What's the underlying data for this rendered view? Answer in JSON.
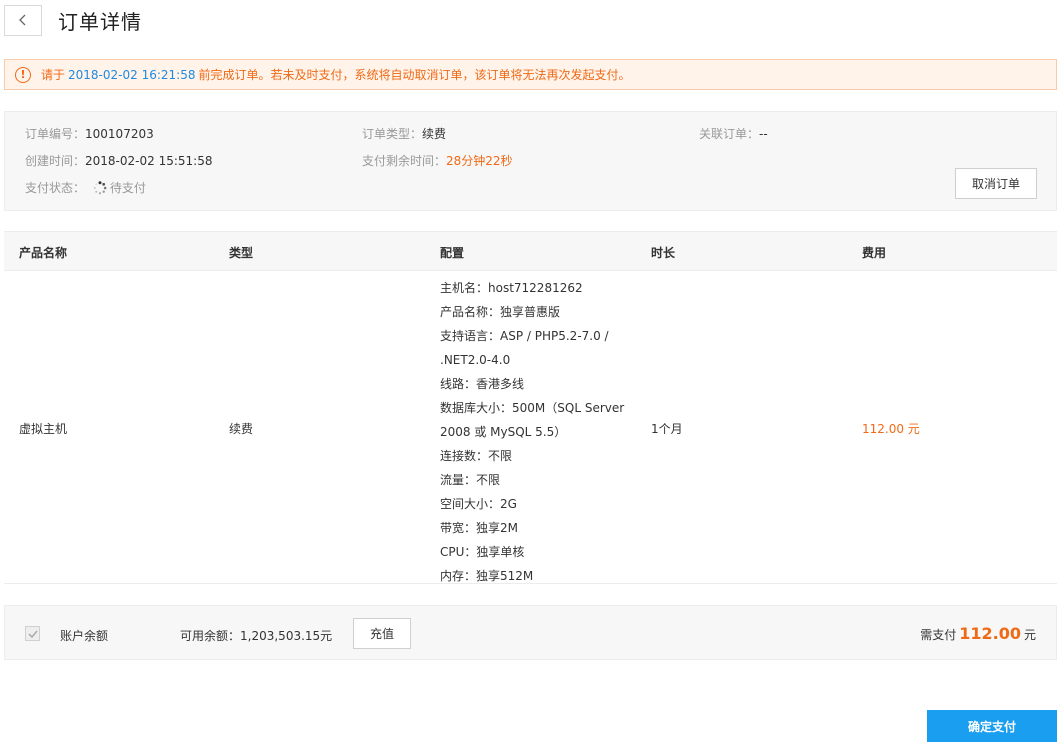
{
  "header": {
    "title": "订单详情"
  },
  "notice": {
    "prefix": "请于",
    "deadline": "2018-02-02 16:21:58",
    "suffix": "前完成订单。若未及时支付，系统将自动取消订单，该订单将无法再次发起支付。"
  },
  "order": {
    "number_label": "订单编号：",
    "number": "100107203",
    "type_label": "订单类型：",
    "type": "续费",
    "related_label": "关联订单：",
    "related": "--",
    "created_label": "创建时间：",
    "created": "2018-02-02 15:51:58",
    "remaining_label": "支付剩余时间：",
    "remaining": "28分钟22秒",
    "status_label": "支付状态：",
    "status": "待支付",
    "cancel_label": "取消订单"
  },
  "table": {
    "headers": [
      "产品名称",
      "类型",
      "配置",
      "时长",
      "费用"
    ],
    "row": {
      "product": "虚拟主机",
      "type": "续费",
      "config": [
        "主机名：host712281262",
        "产品名称：独享普惠版",
        "支持语言：ASP / PHP5.2-7.0 /",
        ".NET2.0-4.0",
        "线路：香港多线",
        "数据库大小：500M（SQL Server",
        "2008 或 MySQL 5.5）",
        "连接数：不限",
        "流量：不限",
        "空间大小：2G",
        "带宽：独享2M",
        "CPU：独享单核",
        "内存：独享512M"
      ],
      "duration": "1个月",
      "fee": "112.00 元"
    }
  },
  "payment": {
    "account_label": "账户余额",
    "balance_label": "可用余额：",
    "balance": "1,203,503.15元",
    "recharge_label": "充值",
    "due_label": "需支付",
    "due_amount": "112.00",
    "due_unit": "元",
    "confirm_label": "确定支付"
  },
  "colors": {
    "accent": "#1a9ef0",
    "warning": "#f06a16"
  },
  "icons": {
    "back": "chevron-left-icon",
    "warning": "warning-circle-icon",
    "status": "spinner-icon",
    "checkbox": "check-icon"
  }
}
